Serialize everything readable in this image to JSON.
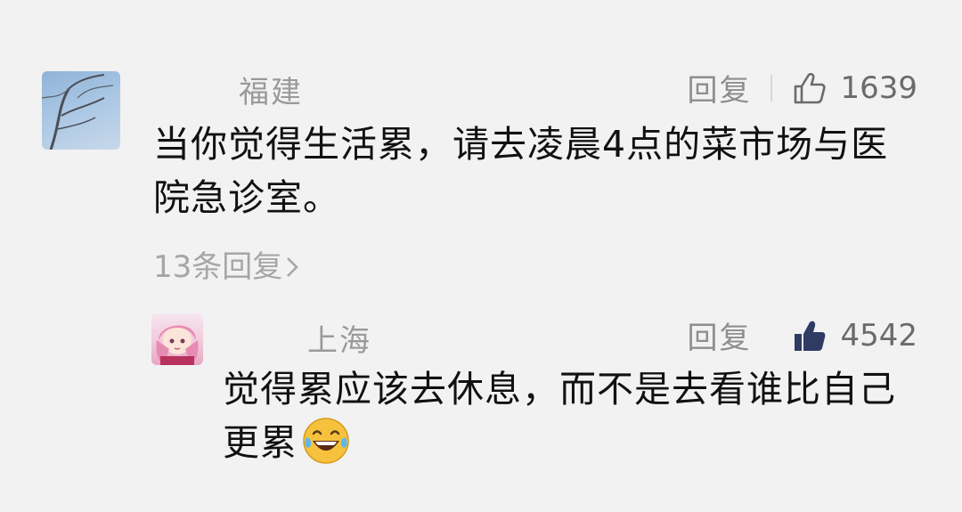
{
  "comment": {
    "username": "福建",
    "reply_label": "回复",
    "likes": "1639",
    "text": "当你觉得生活累，请去凌晨4点的菜市场与医院急诊室。",
    "reply_count_link": "13条回复",
    "avatar_icon": "winter-tree-avatar"
  },
  "reply": {
    "username": "上海",
    "reply_label": "回复",
    "likes": "4542",
    "text": "觉得累应该去休息，而不是去看谁比自己更累",
    "emoji": "laughing-tears-emoji",
    "avatar_icon": "anime-girl-avatar"
  },
  "colors": {
    "background": "#f2f2f2",
    "username": "#9a9a9a",
    "like_active": "#2f3b63",
    "text": "#111111"
  }
}
